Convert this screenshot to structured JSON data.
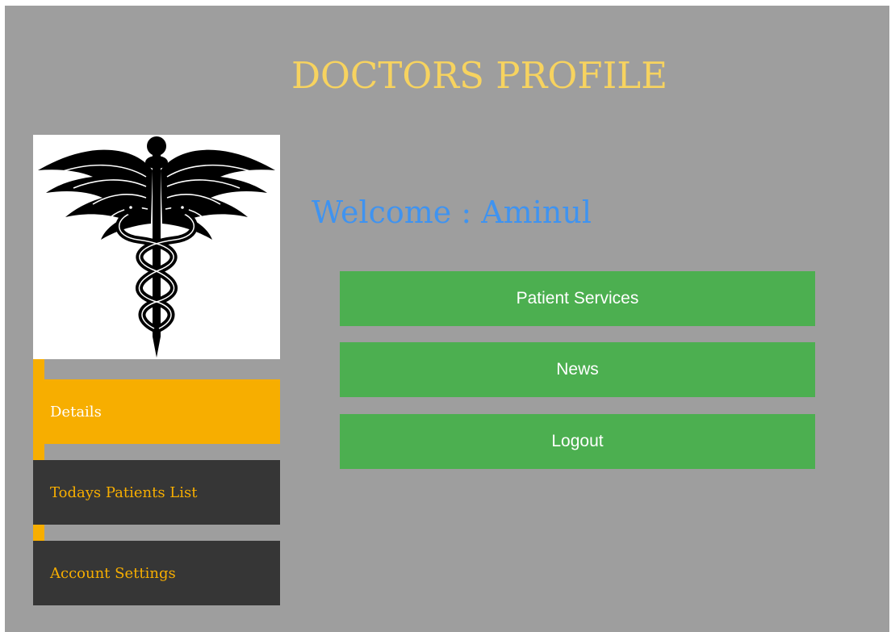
{
  "page": {
    "title": "DOCTORS PROFILE",
    "welcome": "Welcome : Aminul"
  },
  "logo": {
    "icon": "caduceus-icon"
  },
  "sidebar": {
    "items": [
      {
        "label": "Details",
        "active": true
      },
      {
        "label": "Todays Patients List",
        "active": false
      },
      {
        "label": "Account Settings",
        "active": false
      }
    ]
  },
  "actions": {
    "patient_services": "Patient Services",
    "news": "News",
    "logout": "Logout"
  },
  "colors": {
    "background": "#9e9e9e",
    "title": "#f7d35f",
    "accent": "#f7ae00",
    "sidebar_dark": "#363636",
    "welcome": "#3f93f0",
    "button": "#4caf50"
  }
}
